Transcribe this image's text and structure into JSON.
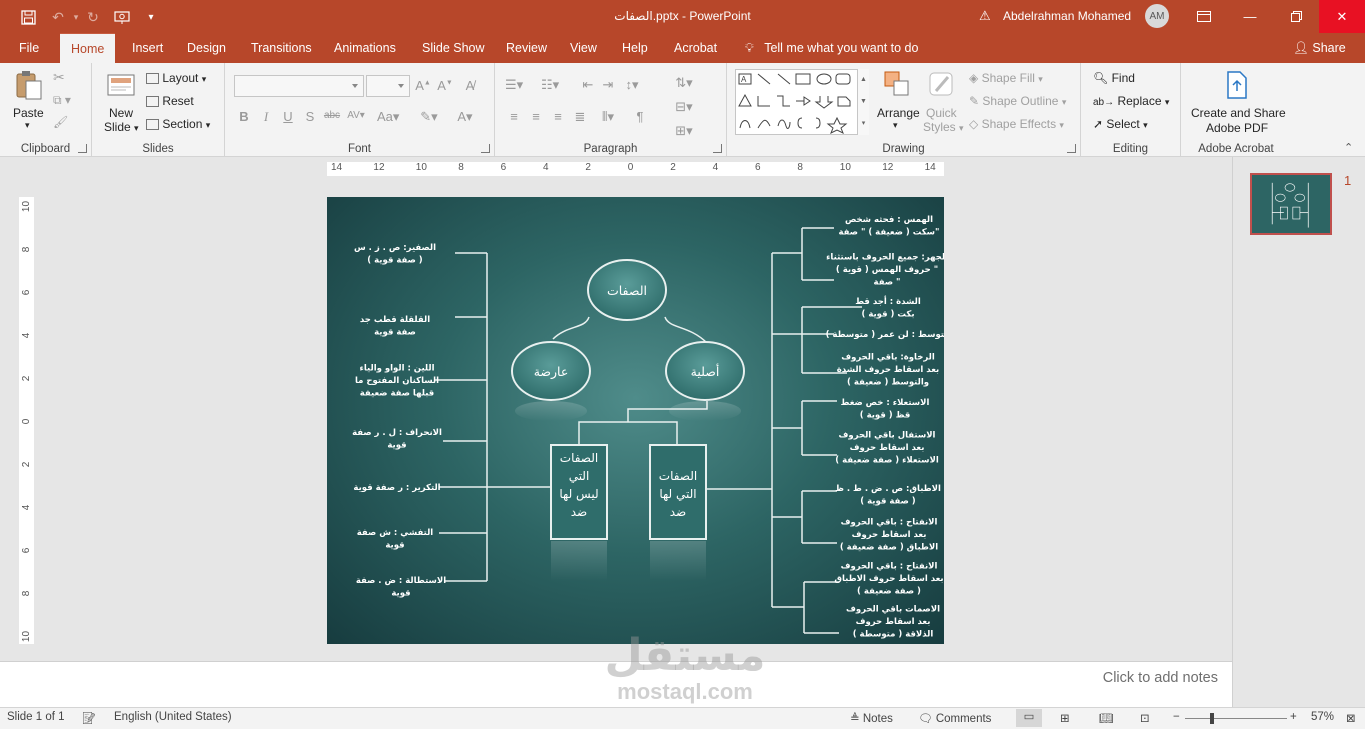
{
  "titlebar": {
    "title": "الصفات.pptx - PowerPoint",
    "user": "Abdelrahman Mohamed",
    "avatar": "AM"
  },
  "tabs": [
    "File",
    "Home",
    "Insert",
    "Design",
    "Transitions",
    "Animations",
    "Slide Show",
    "Review",
    "View",
    "Help",
    "Acrobat"
  ],
  "tell_me": "Tell me what you want to do",
  "share": "Share",
  "ribbon": {
    "clipboard": {
      "label": "Clipboard",
      "paste": "Paste"
    },
    "slides": {
      "label": "Slides",
      "new_slide": "New",
      "new_slide2": "Slide",
      "layout": "Layout",
      "reset": "Reset",
      "section": "Section"
    },
    "font": {
      "label": "Font"
    },
    "paragraph": {
      "label": "Paragraph"
    },
    "drawing": {
      "label": "Drawing",
      "arrange": "Arrange",
      "quick_styles": "Quick",
      "quick_styles2": "Styles",
      "shape_fill": "Shape Fill",
      "shape_outline": "Shape Outline",
      "shape_effects": "Shape Effects"
    },
    "editing": {
      "label": "Editing",
      "find": "Find",
      "replace": "Replace",
      "select": "Select"
    },
    "acrobat": {
      "label": "Adobe Acrobat",
      "create": "Create and Share",
      "create2": "Adobe PDF"
    }
  },
  "ruler_h": [
    "14",
    "12",
    "10",
    "8",
    "6",
    "4",
    "2",
    "0",
    "2",
    "4",
    "6",
    "8",
    "10",
    "12",
    "14"
  ],
  "ruler_v": [
    "10",
    "8",
    "6",
    "4",
    "2",
    "0",
    "2",
    "4",
    "6",
    "8",
    "10"
  ],
  "slide": {
    "root": "الصفات",
    "left_branch": "عارضة",
    "right_branch": "أصلية",
    "box_left": [
      "الصفات",
      "التي",
      "ليس لها",
      "ضد"
    ],
    "box_right": [
      "الصفات",
      "التي لها",
      "ضد"
    ],
    "left_items": [
      [
        "الصفير: ص . ز . س",
        "( صفة قوية )"
      ],
      [
        "القلقلة قطب جد",
        "صفة قوية"
      ],
      [
        "اللين : الواو والياء",
        "الساكنان المفتوح ما",
        "قبلها صفة ضعيفة"
      ],
      [
        "الانحراف : ل . ر صفة",
        "قوية"
      ],
      [
        "التكرير : ر صفة قوية"
      ],
      [
        "التفشي : ش صفة",
        "قوية"
      ],
      [
        "الاستطالة : ض . صفة",
        "قوية"
      ]
    ],
    "right_items": [
      [
        "الهمس : فحثه شخص",
        "سكت ( ضعيفة ) \" صفة\""
      ],
      [
        "الجهر: جميع الحروف باستثناء",
        "حروف الهمس ( قوية ) \"",
        "صفة \""
      ],
      [
        "الشدة : أجد قط",
        "بكت ( قوية )"
      ],
      [
        "التوسط : لن عمر ( متوسطة )"
      ],
      [
        "الرخاوة: باقي الحروف",
        "بعد اسقاط حروف الشدة",
        "والتوسط ( ضعيفة )"
      ],
      [
        "الاستعلاء : خص ضغط",
        "قظ ( قوية )"
      ],
      [
        "الاستفال باقي الحروف",
        "بعد اسقاط حروف",
        "الاستعلاء ( صفة ضعيفة )"
      ],
      [
        "الاطباق: ص . ض . ط . ظ",
        "( صفة قوية )"
      ],
      [
        "الانفتاح : باقي الحروف",
        "بعد اسقاط حروف",
        "الاطباق ( صفة ضعيفة )"
      ],
      [
        "الانفتاح : باقي الحروف",
        "بعد اسقاط حروف الاطباق",
        "( صفة ضعيفة )"
      ],
      [
        "الاصمات باقي الحروف",
        "بعد اسقاط حروف",
        "الذلاقة ( متوسطة )"
      ]
    ]
  },
  "thumb_number": "1",
  "notes_placeholder": "Click to add notes",
  "watermark": {
    "ar": "مستقل",
    "en": "mostaql.com"
  },
  "status": {
    "slide_of": "Slide 1 of 1",
    "language": "English (United States)",
    "notes": "Notes",
    "comments": "Comments",
    "zoom": "57%"
  },
  "colors": {
    "accent": "#b7472a",
    "slide_dark": "#173c3f",
    "slide_mid": "#2d6564"
  }
}
